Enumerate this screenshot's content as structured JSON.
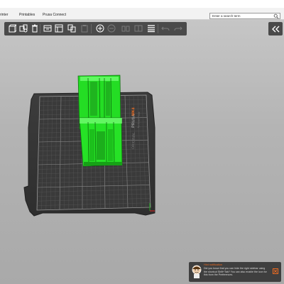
{
  "topbar": {
    "tabs": [
      {
        "label": "rinter"
      },
      {
        "label": "Printables"
      },
      {
        "label": "Prusa Connect"
      }
    ],
    "search": {
      "placeholder": "Enter a search term"
    }
  },
  "toolbar": {
    "buttons": [
      {
        "icon": "add-part-icon",
        "enabled": true
      },
      {
        "icon": "arrange-icon",
        "enabled": true
      },
      {
        "icon": "delete-icon",
        "enabled": true
      },
      {
        "icon": "delete-all-icon",
        "enabled": true
      },
      {
        "icon": "arrange-selection-icon",
        "enabled": true
      },
      {
        "icon": "copy-icon",
        "enabled": true
      },
      {
        "icon": "paste-icon",
        "enabled": false
      },
      {
        "icon": "add-instance-icon",
        "enabled": true
      },
      {
        "icon": "remove-instance-icon",
        "enabled": false
      },
      {
        "icon": "split-objects-icon",
        "enabled": false
      },
      {
        "icon": "split-parts-icon",
        "enabled": false
      },
      {
        "icon": "variable-layer-height-icon",
        "enabled": true
      },
      {
        "icon": "undo-icon",
        "enabled": false
      },
      {
        "icon": "redo-icon",
        "enabled": false
      }
    ]
  },
  "bed": {
    "brand_line1": "ORIGINAL",
    "brand_line2": "PRUSA",
    "brand_line3": "MK4",
    "brand_line4": "by Josef Prusa",
    "model_color": "#22dd22"
  },
  "hint": {
    "title": "Hint notification",
    "body": "Did you know that you can hide the right sidebar using the shortcut Shift+Tab? You can also enable the icon for this from the Preferences."
  }
}
